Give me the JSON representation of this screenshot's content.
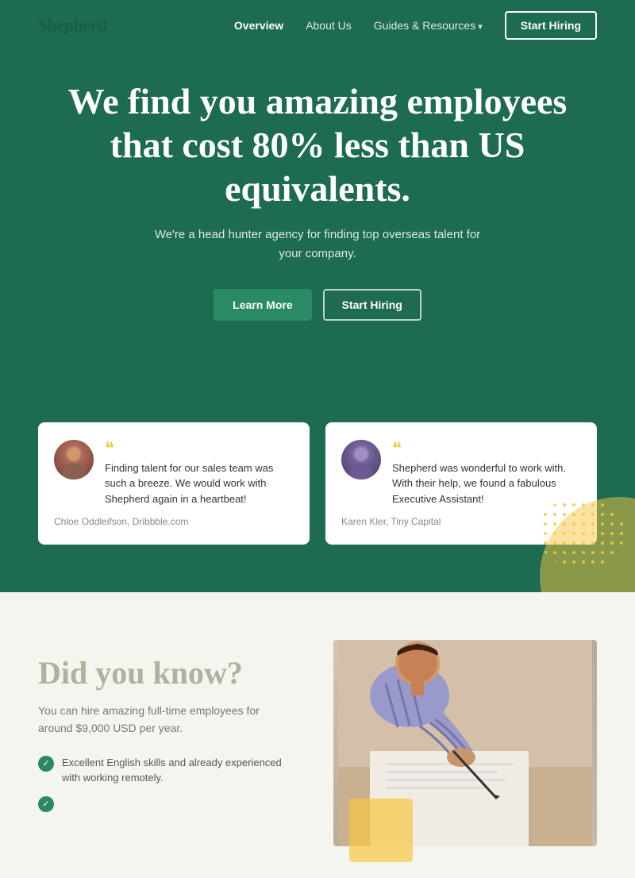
{
  "nav": {
    "logo": "Shepherd",
    "links": [
      {
        "label": "Overview",
        "active": true
      },
      {
        "label": "About Us",
        "active": false
      },
      {
        "label": "Guides & Resources",
        "active": false,
        "has_arrow": true
      }
    ],
    "cta_label": "Start Hiring"
  },
  "hero": {
    "title": "We find you amazing employees that cost 80% less than US equivalents.",
    "subtitle": "We're a head hunter agency for finding top overseas talent for your company.",
    "btn_learn": "Learn More",
    "btn_start": "Start Hiring"
  },
  "testimonials": [
    {
      "quote": "Finding talent for our sales team was such a breeze. We would work with Shepherd again in a heartbeat!",
      "author": "Chloe Oddleifson, Dribbble.com"
    },
    {
      "quote": "Shepherd was wonderful to work with.  With their help, we found a fabulous Executive Assistant!",
      "author": "Karen Kler, Tiny Capital"
    }
  ],
  "did_you_know": {
    "title": "Did you know?",
    "subtitle": "You can hire amazing full-time employees for around $9,000 USD per year.",
    "features": [
      "Excellent English skills and already experienced with working remotely."
    ]
  },
  "colors": {
    "hero_bg": "#1d6b50",
    "accent_green": "#2a8a63",
    "accent_yellow": "#f5c842",
    "text_light": "#ffffff",
    "page_bg": "#f5f5f0"
  }
}
